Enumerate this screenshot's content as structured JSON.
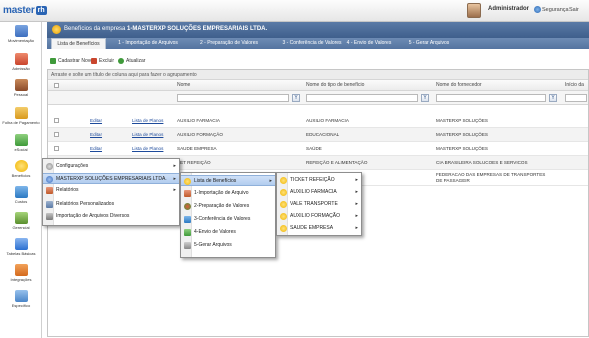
{
  "topbar": {
    "logo_text": "master",
    "logo_box": "rh",
    "user_name": "Administrador",
    "security_label": "Segurança",
    "exit_label": "Sair"
  },
  "sidebar": {
    "items": [
      {
        "label": "Movimentação",
        "icon": "movimentacao-icon",
        "color": "#3d6fbf"
      },
      {
        "label": "Admissão",
        "icon": "admissao-icon",
        "color": "#c9452d"
      },
      {
        "label": "Pessoal",
        "icon": "pessoal-icon",
        "color": "#8a4a2a"
      },
      {
        "label": "Folha de Pagamento",
        "icon": "folha-icon",
        "color": "#d99a1e"
      },
      {
        "label": "eSocial",
        "icon": "esocial-icon",
        "color": "#3f9a3a"
      },
      {
        "label": "Benefícios",
        "icon": "beneficios-icon",
        "color": "#f0b400"
      },
      {
        "label": "Custos",
        "icon": "custos-icon",
        "color": "#2b79c2"
      },
      {
        "label": "Gerencial",
        "icon": "gerencial-icon",
        "color": "#5a8f2e"
      },
      {
        "label": "Tabelas Básicas",
        "icon": "tabelas-icon",
        "color": "#2b6fd0"
      },
      {
        "label": "Integrações",
        "icon": "integracoes-icon",
        "color": "#d46a1d"
      },
      {
        "label": "Específico",
        "icon": "especifico-icon",
        "color": "#4a86c8"
      }
    ]
  },
  "header": {
    "prefix": "Benefícios da empresa ",
    "company": "1-MASTERXP SOLUÇÕES EMPRESARIAIS LTDA."
  },
  "tabs": [
    "Lista de Benefícios",
    "1 - Importação de Arquivos",
    "2 - Preparação de Valores",
    "3 - Conferência de Valores",
    "4 - Envio de Valores",
    "5 - Gerar Arquivos"
  ],
  "toolbar": {
    "new_label": "Cadastrar Novo",
    "delete_label": "Excluir",
    "refresh_label": "Atualizar"
  },
  "grid": {
    "group_hint": "Arraste e solte um título de coluna aqui para fazer o agrupamento",
    "columns": [
      "Nome",
      "Nome do tipo de benefício",
      "Nome do fornecedor",
      "Início da vigência"
    ],
    "filter_btn": "Y",
    "rows": [
      {
        "edit": "Editar",
        "plans": "Lista de Planos",
        "name": "AUXILIO FARMACIA",
        "type": "AUXILIO FARMACIA",
        "supplier": "MASTERXP SOLUÇÕES"
      },
      {
        "edit": "Editar",
        "plans": "Lista de Planos",
        "name": "AUXILIO FORMAÇÃO",
        "type": "EDUCACIONAL",
        "supplier": "MASTERXP SOLUÇÕES"
      },
      {
        "edit": "Editar",
        "plans": "Lista de Planos",
        "name": "SAUDE EMPRESA",
        "type": "SAÚDE",
        "supplier": "MASTERXP SOLUÇÕES"
      },
      {
        "edit": "",
        "plans": "",
        "name": "KET REFEIÇÃO",
        "type": "REFEIÇÃO E ALIMENTAÇÃO",
        "supplier": "CIA BRASILEIRA SOLUCOES E SERVICOS"
      },
      {
        "edit": "",
        "plans": "",
        "name": "",
        "type": "",
        "supplier": "FEDERACAO DAS EMPRESAS DE TRANSPORTES DE PASSAGEIR"
      }
    ]
  },
  "menu1": {
    "items": [
      {
        "label": "Configurações",
        "icon": "config-icon",
        "color": "#888888",
        "submenu": true
      },
      {
        "label": "MASTERXP SOLUÇÕES EMPRESARIAIS LTDA.",
        "icon": "company-icon",
        "color": "#3d6fbf",
        "submenu": true
      },
      {
        "label": "Relatórios",
        "icon": "report-icon",
        "color": "#c05a2a",
        "submenu": true
      },
      {
        "label": "Relatórios Personalizados",
        "icon": "custom-report-icon",
        "color": "#5a7aa6",
        "submenu": false
      },
      {
        "label": "Importação de Arquivos Diversos",
        "icon": "import-icon",
        "color": "#7a7a7a",
        "submenu": false
      }
    ]
  },
  "menu2": {
    "items": [
      {
        "label": "Lista de Benefícios",
        "icon": "list-icon",
        "color": "#f0b400",
        "submenu": true
      },
      {
        "label": "1-Importação de Arquivo",
        "icon": "import-file-icon",
        "color": "#c05a2a",
        "submenu": false
      },
      {
        "label": "2-Preparação de Valores",
        "icon": "prepare-icon",
        "color": "#3f9a3a",
        "submenu": false
      },
      {
        "label": "3-Conferência de Valores",
        "icon": "check-icon",
        "color": "#2b79c2",
        "submenu": false
      },
      {
        "label": "4-Envio de Valores",
        "icon": "send-icon",
        "color": "#3f9a3a",
        "submenu": false
      },
      {
        "label": "5-Gerar Arquivos",
        "icon": "generate-icon",
        "color": "#888888",
        "submenu": false
      }
    ]
  },
  "menu3": {
    "items": [
      {
        "label": "TICKET REFEIÇÃO",
        "icon": "benefit-icon",
        "color": "#f0b400",
        "submenu": true
      },
      {
        "label": "AUXILIO FARMACIA",
        "icon": "benefit-icon",
        "color": "#f0b400",
        "submenu": true
      },
      {
        "label": "VALE TRANSPORTE",
        "icon": "benefit-icon",
        "color": "#f0b400",
        "submenu": true
      },
      {
        "label": "AUXILIO FORMAÇÃO",
        "icon": "benefit-icon",
        "color": "#f0b400",
        "submenu": true
      },
      {
        "label": "SAUDE EMPRESA",
        "icon": "benefit-icon",
        "color": "#f0b400",
        "submenu": true
      }
    ]
  }
}
